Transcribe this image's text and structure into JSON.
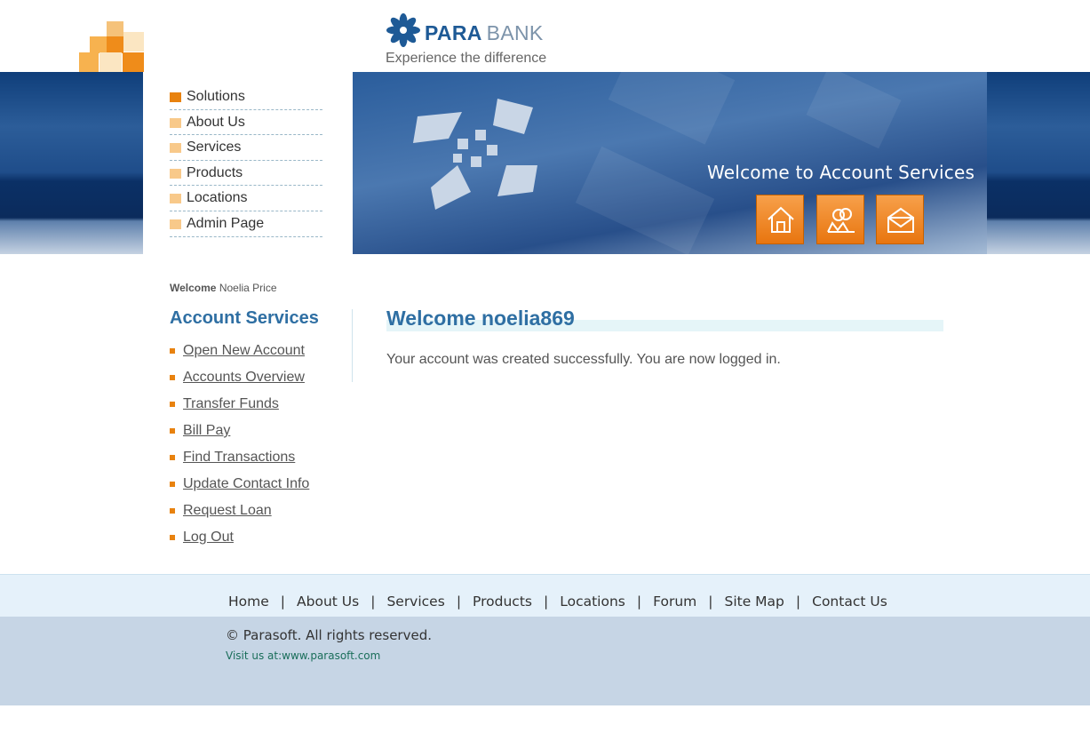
{
  "brand": {
    "name_bold": "PARA",
    "name_light": "BANK",
    "tagline": "Experience the difference"
  },
  "header": {
    "welcome_banner": "Welcome to Account Services",
    "icon_buttons": [
      "home-icon",
      "about-icon",
      "contact-icon"
    ]
  },
  "top_nav": {
    "items": [
      "Solutions",
      "About Us",
      "Services",
      "Products",
      "Locations",
      "Admin Page"
    ]
  },
  "sidebar": {
    "welcome_label": "Welcome",
    "user_name": "Noelia Price",
    "title": "Account Services",
    "links": [
      "Open New Account",
      "Accounts Overview",
      "Transfer Funds",
      "Bill Pay",
      "Find Transactions",
      "Update Contact Info",
      "Request Loan",
      "Log Out"
    ]
  },
  "main": {
    "title": "Welcome noelia869",
    "message": "Your account was created successfully. You are now logged in."
  },
  "footer": {
    "links": [
      "Home",
      "About Us",
      "Services",
      "Products",
      "Locations",
      "Forum",
      "Site Map",
      "Contact Us"
    ],
    "separator": "|",
    "copyright": "© Parasoft. All rights reserved.",
    "visit_label": "Visit us at:",
    "visit_url": "www.parasoft.com"
  },
  "colors": {
    "accent_orange": "#e8820f",
    "title_blue": "#2f6fa3",
    "header_blue": "#1f4d8a"
  }
}
